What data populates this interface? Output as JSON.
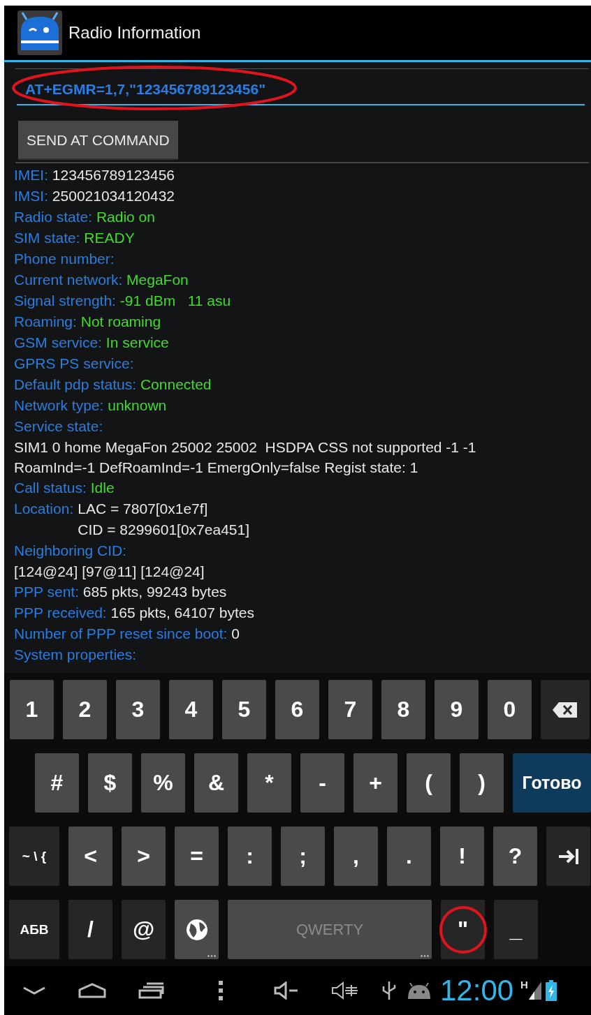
{
  "app_bar": {
    "title": "Radio Information"
  },
  "command": {
    "value": "AT+EGMR=1,7,\"123456789123456\"",
    "circled": true
  },
  "send_button": {
    "label": "SEND AT COMMAND"
  },
  "info": [
    {
      "kind": "field",
      "label": "IMEI:",
      "value": "123456789123456",
      "status": false
    },
    {
      "kind": "field",
      "label": "IMSI:",
      "value": "250021034120432",
      "status": false
    },
    {
      "kind": "field",
      "label": "Radio state:",
      "value": "Radio on",
      "status": true
    },
    {
      "kind": "field",
      "label": "SIM state:",
      "value": "READY",
      "status": true
    },
    {
      "kind": "field",
      "label": "Phone number:"
    },
    {
      "kind": "field",
      "label": "Current network:",
      "value": "MegaFon",
      "status": true
    },
    {
      "kind": "field",
      "label": "Signal strength:",
      "value": "-91 dBm   11 asu",
      "status": true
    },
    {
      "kind": "field",
      "label": "Roaming:",
      "value": "Not roaming",
      "status": true
    },
    {
      "kind": "field",
      "label": "GSM service:",
      "value": "In service",
      "status": true
    },
    {
      "kind": "field",
      "label": "GPRS PS service:"
    },
    {
      "kind": "field",
      "label": "Default pdp status:",
      "value": "Connected",
      "status": true
    },
    {
      "kind": "field",
      "label": "Network type:",
      "value": "unknown",
      "status": true
    },
    {
      "kind": "field",
      "label": "Service state:"
    },
    {
      "kind": "text",
      "text": "SIM1 0 home MegaFon 25002 25002  HSDPA CSS not supported -1 -1 RoamInd=-1 DefRoamInd=-1 EmergOnly=false Regist state: 1"
    },
    {
      "kind": "field",
      "label": "Call status:",
      "value": "Idle",
      "status": true
    },
    {
      "kind": "lines",
      "label": "Location:",
      "lines": [
        "LAC = 7807[0x1e7f]",
        "CID = 8299601[0x7ea451]"
      ]
    },
    {
      "kind": "field",
      "label": "Neighboring CID:"
    },
    {
      "kind": "text",
      "text": "[124@24] [97@11] [124@24]"
    },
    {
      "kind": "field",
      "label": "PPP sent:",
      "value": "685 pkts, 99243 bytes",
      "status": false
    },
    {
      "kind": "field",
      "label": "PPP received:",
      "value": "165 pkts, 64107 bytes",
      "status": false
    },
    {
      "kind": "field",
      "label": "Number of PPP reset since boot:",
      "value": "0",
      "status": false
    },
    {
      "kind": "field",
      "label": "System properties:"
    }
  ],
  "keyboard": [
    [
      {
        "kind": "char",
        "label": "1"
      },
      {
        "kind": "char",
        "label": "2"
      },
      {
        "kind": "char",
        "label": "3"
      },
      {
        "kind": "char",
        "label": "4"
      },
      {
        "kind": "char",
        "label": "5"
      },
      {
        "kind": "char",
        "label": "6"
      },
      {
        "kind": "char",
        "label": "7"
      },
      {
        "kind": "char",
        "label": "8"
      },
      {
        "kind": "char",
        "label": "9"
      },
      {
        "kind": "char",
        "label": "0"
      },
      {
        "kind": "backspace"
      }
    ],
    [
      {
        "kind": "char",
        "label": "#"
      },
      {
        "kind": "char",
        "label": "$"
      },
      {
        "kind": "char",
        "label": "%"
      },
      {
        "kind": "char",
        "label": "&"
      },
      {
        "kind": "char",
        "label": "*"
      },
      {
        "kind": "char",
        "label": "-"
      },
      {
        "kind": "char",
        "label": "+"
      },
      {
        "kind": "char",
        "label": "("
      },
      {
        "kind": "char",
        "label": ")"
      },
      {
        "kind": "done",
        "label": "Готово"
      }
    ],
    [
      {
        "kind": "mode",
        "label": "~ \\ {"
      },
      {
        "kind": "char",
        "label": "<"
      },
      {
        "kind": "char",
        "label": ">"
      },
      {
        "kind": "char",
        "label": "="
      },
      {
        "kind": "char",
        "label": ":"
      },
      {
        "kind": "char",
        "label": ";"
      },
      {
        "kind": "char",
        "label": ","
      },
      {
        "kind": "char",
        "label": "."
      },
      {
        "kind": "char",
        "label": "!"
      },
      {
        "kind": "char",
        "label": "?"
      },
      {
        "kind": "tab"
      }
    ],
    [
      {
        "kind": "mode",
        "label": "АБВ"
      },
      {
        "kind": "alt",
        "label": "/"
      },
      {
        "kind": "alt",
        "label": "@"
      },
      {
        "kind": "globe",
        "more": true
      },
      {
        "kind": "space",
        "label": "QWERTY",
        "more": true
      },
      {
        "kind": "alt",
        "label": "\"",
        "circled": true
      },
      {
        "kind": "alt",
        "label": "_"
      }
    ]
  ],
  "status_bar": {
    "clock": "12:00",
    "network": "H"
  }
}
